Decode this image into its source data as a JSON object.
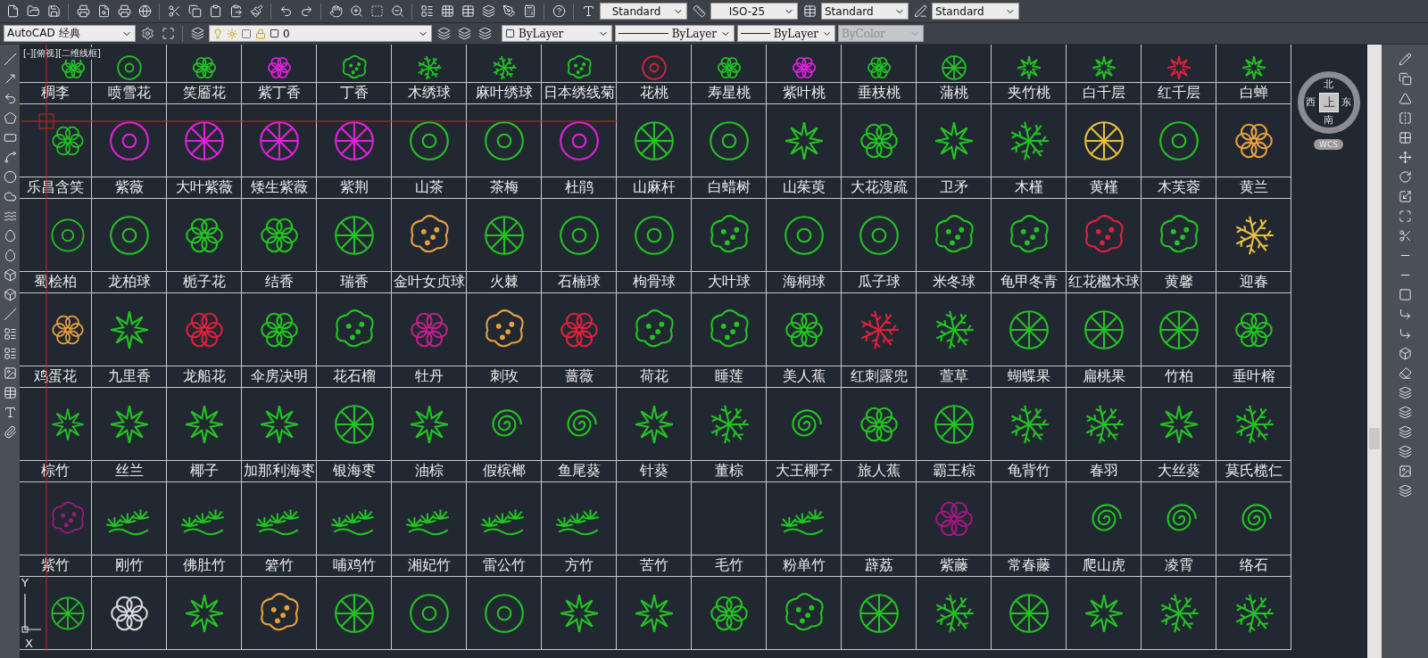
{
  "toolbar": {
    "text_style": "Standard",
    "dim_style": "ISO-25",
    "table_style": "Standard",
    "mleader_style": "Standard",
    "workspace": "AutoCAD 经典",
    "layer": "0",
    "color_setting": "ByLayer",
    "linetype": "ByLayer",
    "lineweight": "ByLayer",
    "plot_style": "ByColor",
    "plot_style_disabled": true
  },
  "viewport_label": "[-][俯视][二维线框]",
  "viewcube": {
    "north": "北",
    "west": "西",
    "east": "东",
    "south": "南",
    "face": "上",
    "ucs": "WCS"
  },
  "ucs_icon": {
    "y": "Y",
    "x": "X"
  },
  "bands": [
    {
      "plants": [
        {
          "kind": "flower",
          "color": "#22c422"
        },
        {
          "kind": "ring",
          "color": "#22c422"
        },
        {
          "kind": "flower",
          "color": "#22c422"
        },
        {
          "kind": "flower",
          "color": "#e020e0"
        },
        {
          "kind": "blob",
          "color": "#22c422"
        },
        {
          "kind": "fern",
          "color": "#22c422"
        },
        {
          "kind": "fern",
          "color": "#22c422"
        },
        {
          "kind": "blob",
          "color": "#22c422"
        },
        {
          "kind": "ring",
          "color": "#e0203c"
        },
        {
          "kind": "flower",
          "color": "#22c422"
        },
        {
          "kind": "flower",
          "color": "#e020e0"
        },
        {
          "kind": "flower",
          "color": "#22c422"
        },
        {
          "kind": "spokes",
          "color": "#22c422"
        },
        {
          "kind": "star",
          "color": "#22c422"
        },
        {
          "kind": "star",
          "color": "#22c422"
        },
        {
          "kind": "star",
          "color": "#e0203c"
        },
        {
          "kind": "star",
          "color": "#22c422"
        }
      ],
      "labels": [
        "稠李",
        "喷雪花",
        "笑靥花",
        "紫丁香",
        "丁香",
        "木绣球",
        "麻叶绣球",
        "日本绣线菊",
        "花桃",
        "寿星桃",
        "紫叶桃",
        "垂枝桃",
        "蒲桃",
        "夹竹桃",
        "白千层",
        "红千层",
        "白蝉"
      ]
    },
    {
      "plants": [
        {
          "kind": "flower",
          "color": "#22c422"
        },
        {
          "kind": "ring",
          "color": "#e020e0"
        },
        {
          "kind": "spokes",
          "color": "#e020e0"
        },
        {
          "kind": "spokes",
          "color": "#e020e0"
        },
        {
          "kind": "spokes",
          "color": "#e020e0"
        },
        {
          "kind": "ring",
          "color": "#22c422"
        },
        {
          "kind": "ring",
          "color": "#22c422"
        },
        {
          "kind": "ring",
          "color": "#e020e0"
        },
        {
          "kind": "spokes",
          "color": "#22c422"
        },
        {
          "kind": "ring",
          "color": "#22c422"
        },
        {
          "kind": "star",
          "color": "#22c422"
        },
        {
          "kind": "flower",
          "color": "#22c422"
        },
        {
          "kind": "star",
          "color": "#22c422"
        },
        {
          "kind": "fern",
          "color": "#22c422"
        },
        {
          "kind": "spokes",
          "color": "#e8c040"
        },
        {
          "kind": "ring",
          "color": "#22c422"
        },
        {
          "kind": "flower",
          "color": "#e8a040"
        }
      ],
      "labels": [
        "乐昌含笑",
        "紫薇",
        "大叶紫薇",
        "矮生紫薇",
        "紫荆",
        "山茶",
        "茶梅",
        "杜鹃",
        "山麻杆",
        "白蜡树",
        "山茱萸",
        "大花溲疏",
        "卫矛",
        "木槿",
        "黄槿",
        "木芙蓉",
        "黄兰"
      ]
    },
    {
      "plants": [
        {
          "kind": "ring",
          "color": "#22c422"
        },
        {
          "kind": "ring",
          "color": "#22c422"
        },
        {
          "kind": "flower",
          "color": "#22c422"
        },
        {
          "kind": "flower",
          "color": "#22c422"
        },
        {
          "kind": "spokes",
          "color": "#22c422"
        },
        {
          "kind": "blob",
          "color": "#e8a040"
        },
        {
          "kind": "spokes",
          "color": "#22c422"
        },
        {
          "kind": "ring",
          "color": "#22c422"
        },
        {
          "kind": "ring",
          "color": "#22c422"
        },
        {
          "kind": "blob",
          "color": "#22c422"
        },
        {
          "kind": "ring",
          "color": "#22c422"
        },
        {
          "kind": "ring",
          "color": "#22c422"
        },
        {
          "kind": "blob",
          "color": "#22c422"
        },
        {
          "kind": "blob",
          "color": "#22c422"
        },
        {
          "kind": "blob",
          "color": "#e0203c"
        },
        {
          "kind": "blob",
          "color": "#22c422"
        },
        {
          "kind": "fern",
          "color": "#e8c040"
        }
      ],
      "labels": [
        "蜀桧柏",
        "龙柏球",
        "栀子花",
        "结香",
        "瑞香",
        "金叶女贞球",
        "火棘",
        "石楠球",
        "枸骨球",
        "大叶球",
        "海桐球",
        "瓜子球",
        "米冬球",
        "龟甲冬青",
        "红花檵木球",
        "黄馨",
        "迎春"
      ]
    },
    {
      "plants": [
        {
          "kind": "flower",
          "color": "#e8a040"
        },
        {
          "kind": "star",
          "color": "#22c422"
        },
        {
          "kind": "flower",
          "color": "#e0203c"
        },
        {
          "kind": "flower",
          "color": "#22c422"
        },
        {
          "kind": "blob",
          "color": "#22c422"
        },
        {
          "kind": "flower",
          "color": "#c0208a"
        },
        {
          "kind": "blob",
          "color": "#e8a040"
        },
        {
          "kind": "flower",
          "color": "#e0203c"
        },
        {
          "kind": "blob",
          "color": "#22c422"
        },
        {
          "kind": "blob",
          "color": "#22c422"
        },
        {
          "kind": "flower",
          "color": "#22c422"
        },
        {
          "kind": "fern",
          "color": "#e0203c"
        },
        {
          "kind": "fern",
          "color": "#22c422"
        },
        {
          "kind": "spokes",
          "color": "#22c422"
        },
        {
          "kind": "spokes",
          "color": "#22c422"
        },
        {
          "kind": "spokes",
          "color": "#22c422"
        },
        {
          "kind": "flower",
          "color": "#22c422"
        }
      ],
      "labels": [
        "鸡蛋花",
        "九里香",
        "龙船花",
        "伞房决明",
        "花石榴",
        "牡丹",
        "刺玫",
        "蔷薇",
        "荷花",
        "睡莲",
        "美人蕉",
        "红刺露兜",
        "萱草",
        "蝴蝶果",
        "扁桃果",
        "竹柏",
        "垂叶榕"
      ]
    },
    {
      "plants": [
        {
          "kind": "star",
          "color": "#22c422"
        },
        {
          "kind": "star",
          "color": "#22c422"
        },
        {
          "kind": "star",
          "color": "#22c422"
        },
        {
          "kind": "star",
          "color": "#22c422"
        },
        {
          "kind": "spokes",
          "color": "#22c422"
        },
        {
          "kind": "star",
          "color": "#22c422"
        },
        {
          "kind": "spiral",
          "color": "#22c422"
        },
        {
          "kind": "spiral",
          "color": "#22c422"
        },
        {
          "kind": "star",
          "color": "#22c422"
        },
        {
          "kind": "fern",
          "color": "#22c422"
        },
        {
          "kind": "spiral",
          "color": "#22c422"
        },
        {
          "kind": "flower",
          "color": "#22c422"
        },
        {
          "kind": "spokes",
          "color": "#22c422"
        },
        {
          "kind": "fern",
          "color": "#22c422"
        },
        {
          "kind": "fern",
          "color": "#22c422"
        },
        {
          "kind": "star",
          "color": "#22c422"
        },
        {
          "kind": "fern",
          "color": "#22c422"
        }
      ],
      "labels": [
        "棕竹",
        "丝兰",
        "椰子",
        "加那利海枣",
        "银海枣",
        "油棕",
        "假槟榔",
        "鱼尾葵",
        "针葵",
        "董棕",
        "大王椰子",
        "旅人蕉",
        "霸王棕",
        "龟背竹",
        "春羽",
        "大丝葵",
        "莫氏榄仁"
      ]
    },
    {
      "plants": [
        {
          "kind": "blob",
          "color": "#a01880"
        },
        {
          "kind": "bamboo",
          "color": "#22c422"
        },
        {
          "kind": "bamboo",
          "color": "#22c422"
        },
        {
          "kind": "bamboo",
          "color": "#22c422"
        },
        {
          "kind": "bamboo",
          "color": "#22c422"
        },
        {
          "kind": "bamboo",
          "color": "#22c422"
        },
        {
          "kind": "bamboo",
          "color": "#22c422"
        },
        {
          "kind": "bamboo",
          "color": "#22c422"
        },
        {
          "kind": "none"
        },
        {
          "kind": "none"
        },
        {
          "kind": "bamboo",
          "color": "#22c422"
        },
        {
          "kind": "none"
        },
        {
          "kind": "flower",
          "color": "#a01880"
        },
        {
          "kind": "none"
        },
        {
          "kind": "spiral",
          "color": "#22c422"
        },
        {
          "kind": "spiral",
          "color": "#22c422"
        },
        {
          "kind": "spiral",
          "color": "#22c422"
        }
      ],
      "labels": [
        "紫竹",
        "刚竹",
        "佛肚竹",
        "箬竹",
        "哺鸡竹",
        "湘妃竹",
        "雷公竹",
        "方竹",
        "苦竹",
        "毛竹",
        "粉单竹",
        "薜荔",
        "紫藤",
        "常春藤",
        "爬山虎",
        "凌霄",
        "络石"
      ]
    },
    {
      "plants": [
        {
          "kind": "spokes",
          "color": "#22c422"
        },
        {
          "kind": "flower",
          "color": "#d8d8d8"
        },
        {
          "kind": "star",
          "color": "#22c422"
        },
        {
          "kind": "blob",
          "color": "#e8a040"
        },
        {
          "kind": "spokes",
          "color": "#22c422"
        },
        {
          "kind": "ring",
          "color": "#22c422"
        },
        {
          "kind": "ring",
          "color": "#22c422"
        },
        {
          "kind": "star",
          "color": "#22c422"
        },
        {
          "kind": "star",
          "color": "#22c422"
        },
        {
          "kind": "flower",
          "color": "#22c422"
        },
        {
          "kind": "blob",
          "color": "#22c422"
        },
        {
          "kind": "spokes",
          "color": "#22c422"
        },
        {
          "kind": "fern",
          "color": "#22c422"
        },
        {
          "kind": "spokes",
          "color": "#22c422"
        },
        {
          "kind": "star",
          "color": "#22c422"
        },
        {
          "kind": "fern",
          "color": "#22c422"
        },
        {
          "kind": "fern",
          "color": "#22c422"
        }
      ]
    }
  ]
}
